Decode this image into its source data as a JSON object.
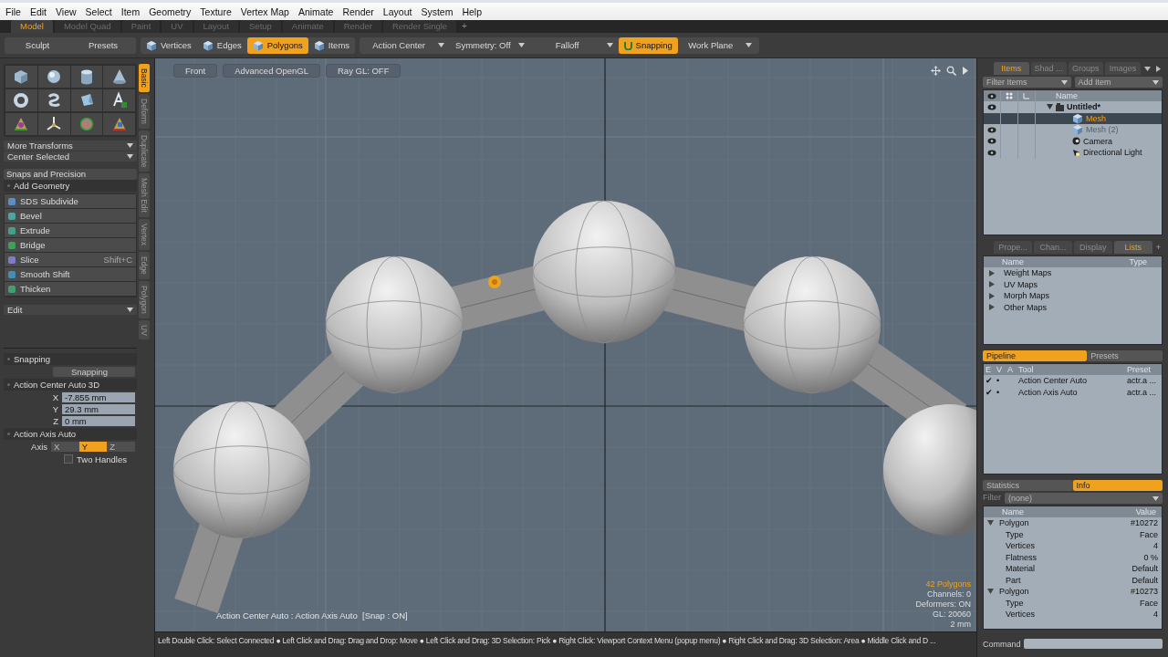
{
  "menu": [
    "File",
    "Edit",
    "View",
    "Select",
    "Item",
    "Geometry",
    "Texture",
    "Vertex Map",
    "Animate",
    "Render",
    "Layout",
    "System",
    "Help"
  ],
  "layout_tabs": [
    {
      "label": "Model",
      "selected": true
    },
    {
      "label": "Model Quad",
      "selected": false
    },
    {
      "label": "Paint",
      "selected": false
    },
    {
      "label": "UV",
      "selected": false
    },
    {
      "label": "Layout",
      "selected": false
    },
    {
      "label": "Setup",
      "selected": false
    },
    {
      "label": "Animate",
      "selected": false
    },
    {
      "label": "Render",
      "selected": false
    },
    {
      "label": "Render Single",
      "selected": false
    }
  ],
  "layout_add": "+",
  "toolbar": {
    "left_buttons": [
      "Sculpt",
      "Presets"
    ],
    "modes": [
      {
        "label": "Vertices",
        "selected": false
      },
      {
        "label": "Edges",
        "selected": false
      },
      {
        "label": "Polygons",
        "selected": true
      },
      {
        "label": "Items",
        "selected": false
      }
    ],
    "controls": [
      {
        "kind": "dropdown",
        "label": "Action Center"
      },
      {
        "kind": "dropdown",
        "label": "Symmetry: Off"
      },
      {
        "kind": "dropdown",
        "label": "Falloff"
      },
      {
        "kind": "toggle",
        "label": "Snapping",
        "on": true
      },
      {
        "kind": "dropdown",
        "label": "Work Plane"
      }
    ]
  },
  "left_panel": {
    "dropdowns": [
      "More Transforms",
      "Center Selected"
    ],
    "snaps_header": "Snaps and Precision",
    "section": "Add Geometry",
    "tools": [
      {
        "label": "SDS Subdivide"
      },
      {
        "label": "Bevel"
      },
      {
        "label": "Extrude"
      },
      {
        "label": "Bridge"
      },
      {
        "label": "Slice",
        "shortcut": "Shift+C"
      },
      {
        "label": "Smooth Shift"
      },
      {
        "label": "Thicken"
      }
    ],
    "edit_dropdown": "Edit",
    "side_tabs": [
      {
        "label": "Basic",
        "selected": true
      },
      {
        "label": "Deform",
        "selected": false
      },
      {
        "label": "Duplicate",
        "selected": false
      },
      {
        "label": "Mesh Edit",
        "selected": false
      },
      {
        "label": "Vertex",
        "selected": false
      },
      {
        "label": "Edge",
        "selected": false
      },
      {
        "label": "Polygon",
        "selected": false
      },
      {
        "label": "UV",
        "selected": false
      }
    ]
  },
  "tool_properties": {
    "snapping_header": "Snapping",
    "snapping_button": "Snapping",
    "action_center_header": "Action Center Auto 3D",
    "coords": [
      {
        "axis": "X",
        "value": "-7.855 mm"
      },
      {
        "axis": "Y",
        "value": "29.3 mm"
      },
      {
        "axis": "Z",
        "value": "0 mm"
      }
    ],
    "action_axis_header": "Action Axis Auto",
    "axis_label": "Axis",
    "axis_options": [
      {
        "label": "X",
        "selected": false
      },
      {
        "label": "Y",
        "selected": true
      },
      {
        "label": "Z",
        "selected": false
      }
    ],
    "two_handles": {
      "label": "Two Handles",
      "checked": false
    }
  },
  "viewport": {
    "buttons": [
      "Front",
      "Advanced OpenGL",
      "Ray GL: OFF"
    ],
    "status_text": "Action Center Auto : Action Axis Auto  [Snap : ON]",
    "info": [
      {
        "text": "42 Polygons",
        "highlight": true
      },
      {
        "text": "Channels: 0",
        "highlight": false
      },
      {
        "text": "Deformers: ON",
        "highlight": false
      },
      {
        "text": "GL: 20060",
        "highlight": false
      },
      {
        "text": "2 mm",
        "highlight": false
      }
    ]
  },
  "items_panel": {
    "tabs": [
      {
        "label": "Items",
        "selected": true
      },
      {
        "label": "Shad ...",
        "selected": false
      },
      {
        "label": "Groups",
        "selected": false
      },
      {
        "label": "Images",
        "selected": false
      }
    ],
    "filter": "Filter Items",
    "add": "Add Item",
    "name_header": "Name",
    "tree": [
      {
        "label": "Untitled*",
        "kind": "scene",
        "visible": true,
        "selected": false,
        "disabled": false,
        "expanded": true,
        "children": [
          {
            "label": "Mesh",
            "kind": "mesh",
            "visible": false,
            "selected": true,
            "disabled": false
          },
          {
            "label": "Mesh (2)",
            "kind": "mesh",
            "visible": true,
            "selected": false,
            "disabled": true
          },
          {
            "label": "Camera",
            "kind": "camera",
            "visible": true,
            "selected": false,
            "disabled": false
          },
          {
            "label": "Directional Light",
            "kind": "light",
            "visible": true,
            "selected": false,
            "disabled": false
          }
        ]
      }
    ]
  },
  "lists_panel": {
    "tabs": [
      {
        "label": "Prope...",
        "selected": false
      },
      {
        "label": "Chan...",
        "selected": false
      },
      {
        "label": "Display",
        "selected": false
      },
      {
        "label": "Lists",
        "selected": true
      }
    ],
    "add_tab": "+",
    "columns": [
      "Name",
      "Type"
    ],
    "rows": [
      {
        "label": "Weight Maps",
        "expanded": false
      },
      {
        "label": "UV Maps",
        "expanded": false
      },
      {
        "label": "Morph Maps",
        "expanded": false
      },
      {
        "label": "Other Maps",
        "expanded": false
      }
    ]
  },
  "pipeline": {
    "tabs": [
      {
        "label": "Pipeline",
        "selected": true
      },
      {
        "label": "Presets",
        "selected": false
      }
    ],
    "columns": [
      "E",
      "V",
      "A",
      "Tool",
      "Preset"
    ],
    "rows": [
      {
        "e": "✔",
        "v": "•",
        "tool": "Action Center Auto",
        "preset": "actr.a ..."
      },
      {
        "e": "✔",
        "v": "•",
        "tool": "Action Axis Auto",
        "preset": "actr.a ..."
      }
    ]
  },
  "info_panel": {
    "tabs": [
      {
        "label": "Statistics",
        "selected": false
      },
      {
        "label": "Info",
        "selected": true
      }
    ],
    "filter_label": "Filter",
    "filter_value": "(none)",
    "columns": [
      "Name",
      "Value"
    ],
    "rows": [
      {
        "name": "Polygon",
        "value": "#10272",
        "expanded": true,
        "children": [
          {
            "name": "Type",
            "value": "Face"
          },
          {
            "name": "Vertices",
            "value": "4"
          },
          {
            "name": "Flatness",
            "value": "0 %"
          },
          {
            "name": "Material",
            "value": "Default"
          },
          {
            "name": "Part",
            "value": "Default"
          }
        ]
      },
      {
        "name": "Polygon",
        "value": "#10273",
        "expanded": true,
        "children": [
          {
            "name": "Type",
            "value": "Face"
          },
          {
            "name": "Vertices",
            "value": "4"
          }
        ]
      }
    ]
  },
  "command_label": "Command",
  "status_bar": "Left Double Click: Select Connected ● Left Click and Drag: Drag and Drop: Move ● Left Click and Drag: 3D Selection: Pick ● Right Click: Viewport Context Menu (popup menu) ● Right Click and Drag: 3D Selection: Area ● Middle Click and D ..."
}
